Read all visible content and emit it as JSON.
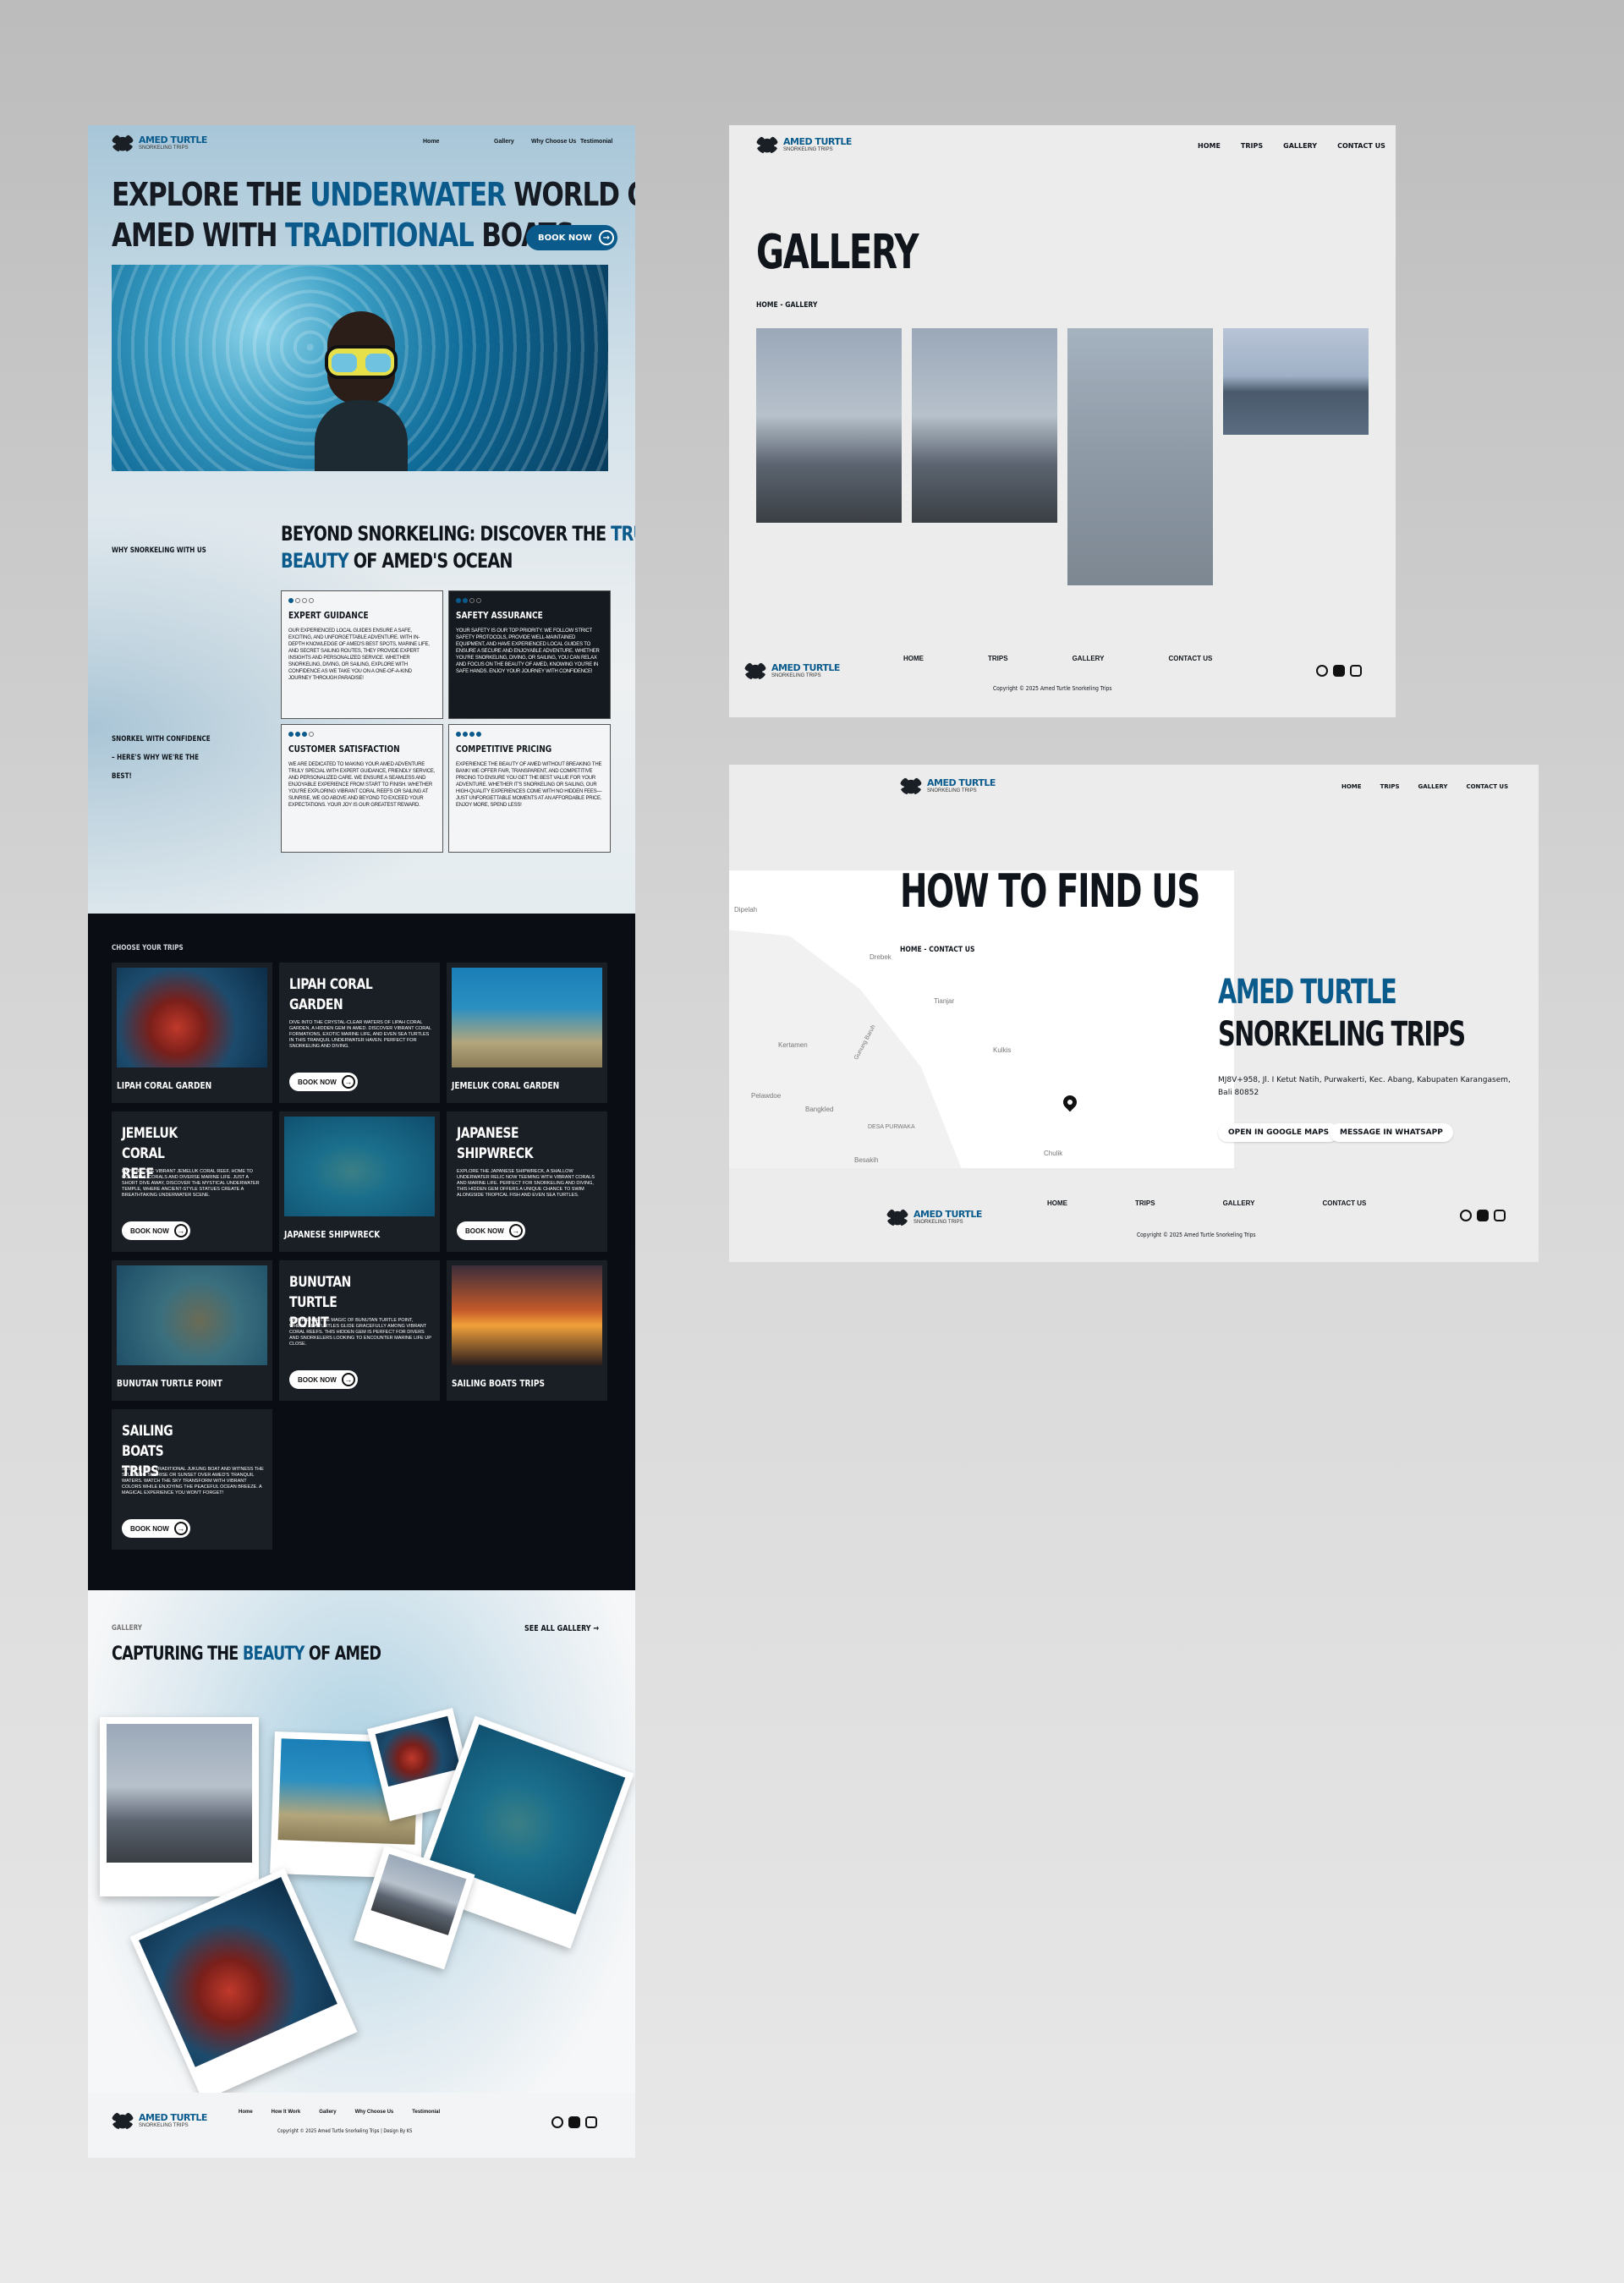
{
  "brand": {
    "name": "AMED TURTLE",
    "tagline": "SNORKELING TRIPS"
  },
  "home": {
    "nav": [
      "Home",
      "Gallery",
      "Why Choose Us",
      "Testimonial"
    ],
    "hero": {
      "line1_a": "EXPLORE THE ",
      "line1_hl": "UNDERWATER",
      "line1_b": " WORLD OF",
      "line2_a": "AMED WITH ",
      "line2_hl": "TRADITIONAL",
      "line2_b": " BOATS",
      "cta": "BOOK NOW"
    },
    "why": {
      "label": "WHY SNORKELING WITH US",
      "title_a": "BEYOND SNORKELING: DISCOVER THE ",
      "title_hl": "TRUE",
      "title_hl2": "BEAUTY",
      "title_b": " OF AMED'S OCEAN",
      "side1": "SNORKEL WITH CONFIDENCE",
      "side2": "– HERE'S WHY WE'RE THE",
      "side3": "BEST!",
      "cards": [
        {
          "title": "EXPERT GUIDANCE",
          "text": "OUR EXPERIENCED LOCAL GUIDES ENSURE A SAFE, EXCITING, AND UNFORGETTABLE ADVENTURE. WITH IN-DEPTH KNOWLEDGE OF AMED'S BEST SPOTS, MARINE LIFE, AND SECRET SAILING ROUTES, THEY PROVIDE EXPERT INSIGHTS AND PERSONALIZED SERVICE. WHETHER SNORKELING, DIVING, OR SAILING, EXPLORE WITH CONFIDENCE AS WE TAKE YOU ON A ONE-OF-A-KIND JOURNEY THROUGH PARADISE!"
        },
        {
          "title": "SAFETY ASSURANCE",
          "text": "YOUR SAFETY IS OUR TOP PRIORITY. WE FOLLOW STRICT SAFETY PROTOCOLS, PROVIDE WELL-MAINTAINED EQUIPMENT, AND HAVE EXPERIENCED LOCAL GUIDES TO ENSURE A SECURE AND ENJOYABLE ADVENTURE. WHETHER YOU'RE SNORKELING, DIVING, OR SAILING, YOU CAN RELAX AND FOCUS ON THE BEAUTY OF AMED, KNOWING YOU'RE IN SAFE HANDS. ENJOY YOUR JOURNEY WITH CONFIDENCE!"
        },
        {
          "title": "CUSTOMER SATISFACTION",
          "text": "WE ARE DEDICATED TO MAKING YOUR AMED ADVENTURE TRULY SPECIAL WITH EXPERT GUIDANCE, FRIENDLY SERVICE, AND PERSONALIZED CARE. WE ENSURE A SEAMLESS AND ENJOYABLE EXPERIENCE FROM START TO FINISH. WHETHER YOU'RE EXPLORING VIBRANT CORAL REEFS OR SAILING AT SUNRISE, WE GO ABOVE AND BEYOND TO EXCEED YOUR EXPECTATIONS. YOUR JOY IS OUR GREATEST REWARD."
        },
        {
          "title": "COMPETITIVE PRICING",
          "text": "EXPERIENCE THE BEAUTY OF AMED WITHOUT BREAKING THE BANK! WE OFFER FAIR, TRANSPARENT, AND COMPETITIVE PRICING TO ENSURE YOU GET THE BEST VALUE FOR YOUR ADVENTURE. WHETHER IT'S SNORKELING OR SAILING, OUR HIGH-QUALITY EXPERIENCES COME WITH NO HIDDEN FEES—JUST UNFORGETTABLE MOMENTS AT AN AFFORDABLE PRICE. ENJOY MORE, SPEND LESS!"
        }
      ]
    },
    "trips": {
      "label": "CHOOSE YOUR TRIPS",
      "book": "BOOK NOW",
      "lipah_img": "LIPAH CORAL GARDEN",
      "lipah_title": "LIPAH CORAL GARDEN",
      "lipah_text": "DIVE INTO THE CRYSTAL-CLEAR WATERS OF LIPAH CORAL GARDEN, A HIDDEN GEM IN AMED. DISCOVER VIBRANT CORAL FORMATIONS, EXOTIC MARINE LIFE, AND EVEN SEA TURTLES IN THIS TRANQUIL UNDERWATER HAVEN. PERFECT FOR SNORKELING AND DIVING.",
      "jemeluk_img": "JEMELUK CORAL GARDEN",
      "jemeluk_title": "JEMELUK CORAL REEF",
      "jemeluk_text": "EXPLORE THE VIBRANT JEMELUK CORAL REEF, HOME TO COLORFUL CORALS AND DIVERSE MARINE LIFE. JUST A SHORT DIVE AWAY, DISCOVER THE MYSTICAL UNDERWATER TEMPLE, WHERE ANCIENT-STYLE STATUES CREATE A BREATHTAKING UNDERWATER SCENE.",
      "ship_img": "JAPANESE SHIPWRECK",
      "ship_title": "JAPANESE SHIPWRECK",
      "ship_text": "EXPLORE THE JAPANESE SHIPWRECK, A SHALLOW UNDERWATER RELIC NOW TEEMING WITH VIBRANT CORALS AND MARINE LIFE. PERFECT FOR SNORKELING AND DIVING, THIS HIDDEN GEM OFFERS A UNIQUE CHANCE TO SWIM ALONGSIDE TROPICAL FISH AND EVEN SEA TURTLES.",
      "bunutan_img": "BUNUTAN TURTLE POINT",
      "bunutan_title": "BUNUTAN TURTLE POINT",
      "bunutan_text": "EXPERIENCE THE MAGIC OF BUNUTAN TURTLE POINT, WHERE SEA TURTLES GLIDE GRACEFULLY AMONG VIBRANT CORAL REEFS. THIS HIDDEN GEM IS PERFECT FOR DIVERS AND SNORKELERS LOOKING TO ENCOUNTER MARINE LIFE UP CLOSE.",
      "sailing_img": "SAILING BOATS TRIPS",
      "sailing_title": "SAILING BOATS TRIPS",
      "sailing_text": "SET SAIL ON A TRADITIONAL JUKUNG BOAT AND WITNESS THE STUNNING SUNRISE OR SUNSET OVER AMED'S TRANQUIL WATERS. WATCH THE SKY TRANSFORM WITH VIBRANT COLORS WHILE ENJOYING THE PEACEFUL OCEAN BREEZE. A MAGICAL EXPERIENCE YOU WON'T FORGET!"
    },
    "gallery": {
      "label": "GALLERY",
      "see_all": "SEE ALL GALLERY",
      "title_a": "CAPTURING THE ",
      "title_hl": "BEAUTY",
      "title_b": " OF AMED"
    },
    "footer": {
      "links": [
        "Home",
        "How It Work",
        "Gallery",
        "Why Choose Us",
        "Testimonial"
      ],
      "copyright": "Copyright © 2025 Amed Turtle Snorkeling Trips | Design By KS"
    }
  },
  "gallery_page": {
    "nav": [
      "HOME",
      "TRIPS",
      "GALLERY",
      "CONTACT US"
    ],
    "title": "GALLERY",
    "crumb": "HOME - GALLERY",
    "footer_links": [
      "HOME",
      "TRIPS",
      "GALLERY",
      "CONTACT US"
    ],
    "copyright": "Copyright © 2025 Amed Turtle Snorkeling Trips"
  },
  "contact_page": {
    "nav": [
      "HOME",
      "TRIPS",
      "GALLERY",
      "CONTACT US"
    ],
    "title": "HOW TO FIND US",
    "crumb": "HOME - CONTACT US",
    "heading_line1": "AMED TURTLE",
    "heading_line2": "SNORKELING TRIPS",
    "address": "MJ8V+958, Jl. I Ketut Natih, Purwakerti, Kec. Abang, Kabupaten Karangasem, Bali 80852",
    "btn_maps": "OPEN IN GOOGLE MAPS",
    "btn_wa": "MESSAGE IN WHATSAPP",
    "map_labels": [
      "Dipelah",
      "Drebek",
      "Tianjar",
      "Kertamen",
      "Kulkis",
      "Pelawdoe",
      "Bangkled",
      "DESA PURWAKA",
      "Besakih",
      "Chulik",
      "Gunung Baruh"
    ],
    "footer_links": [
      "HOME",
      "TRIPS",
      "GALLERY",
      "CONTACT US"
    ],
    "copyright": "Copyright © 2025 Amed Turtle Snorkeling Trips"
  },
  "colors": {
    "accent": "#0b5a8c",
    "dark": "#0a0e14"
  },
  "icons": [
    "turtle-logo-icon",
    "arrow-right-icon",
    "whatsapp-icon",
    "facebook-icon",
    "instagram-icon",
    "map-pin-icon"
  ]
}
